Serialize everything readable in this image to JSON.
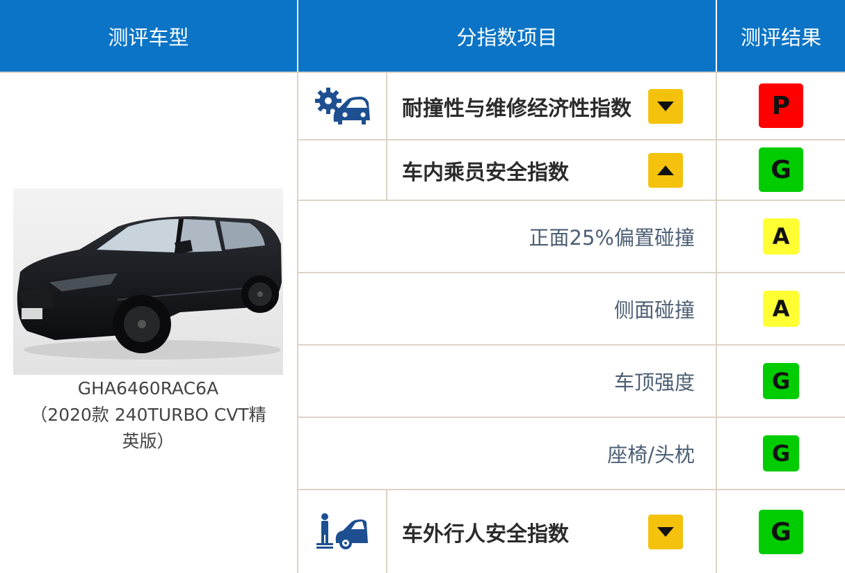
{
  "header": {
    "col_model": "测评车型",
    "col_index": "分指数项目",
    "col_result": "测评结果"
  },
  "vehicle": {
    "caption_line1": "GHA6460RAC6A",
    "caption_line2": "（2020款 240TURBO CVT精",
    "caption_line3": "英版）"
  },
  "indices": [
    {
      "title": "耐撞性与维修经济性指数",
      "toggle": "expand",
      "grade": "P",
      "grade_color": "#ff0000",
      "icon": "repair-car-icon"
    },
    {
      "title": "车内乘员安全指数",
      "toggle": "collapse",
      "grade": "G",
      "grade_color": "#00cc00",
      "icon": ""
    },
    {
      "title": "车外行人安全指数",
      "toggle": "expand",
      "grade": "G",
      "grade_color": "#00cc00",
      "icon": "pedestrian-car-icon"
    }
  ],
  "sub_items": [
    {
      "label": "正面25%偏置碰撞",
      "grade": "A",
      "grade_color": "#ffff33"
    },
    {
      "label": "侧面碰撞",
      "grade": "A",
      "grade_color": "#ffff33"
    },
    {
      "label": "车顶强度",
      "grade": "G",
      "grade_color": "#00cc00"
    },
    {
      "label": "座椅/头枕",
      "grade": "G",
      "grade_color": "#00cc00"
    }
  ],
  "colors": {
    "header_blue": "#0b74c6",
    "toggle_yellow": "#f4c20d",
    "icon_blue": "#1d4f91"
  }
}
